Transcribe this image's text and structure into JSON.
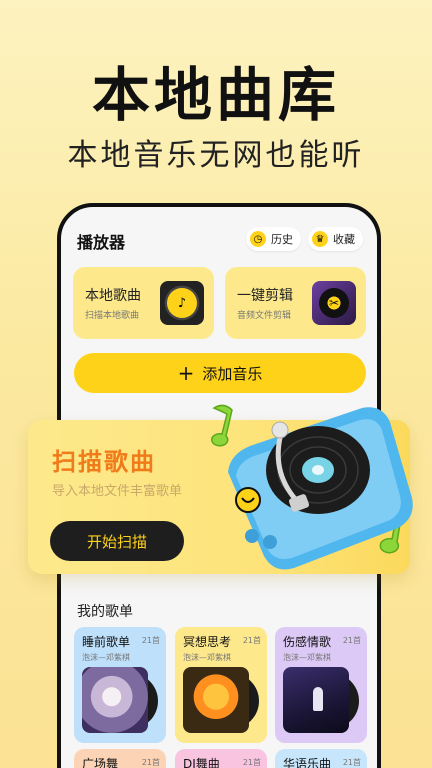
{
  "hero": {
    "title": "本地曲库",
    "subtitle": "本地音乐无网也能听"
  },
  "player": {
    "title": "播放器",
    "history_label": "历史",
    "favorites_label": "收藏",
    "cards": [
      {
        "title": "本地歌曲",
        "subtitle": "扫描本地歌曲"
      },
      {
        "title": "一键剪辑",
        "subtitle": "音频文件剪辑"
      }
    ],
    "add_music_label": "添加音乐"
  },
  "scan": {
    "title": "扫描歌曲",
    "subtitle": "导入本地文件丰富歌单",
    "button_label": "开始扫描"
  },
  "playlists": {
    "section_title": "我的歌单",
    "items": [
      {
        "name": "睡前歌单",
        "count": "21首",
        "artist": "泡沫—邓紫棋"
      },
      {
        "name": "冥想思考",
        "count": "21首",
        "artist": "泡沫—邓紫棋"
      },
      {
        "name": "伤感情歌",
        "count": "21首",
        "artist": "泡沫—邓紫棋"
      },
      {
        "name": "广场舞",
        "count": "21首"
      },
      {
        "name": "DJ舞曲",
        "count": "21首"
      },
      {
        "name": "华语乐曲",
        "count": "21首"
      }
    ]
  },
  "colors": {
    "accent": "#ffd21a",
    "scan_title": "#f07b1a",
    "dark": "#1e1e1e"
  },
  "icons": [
    "clock-icon",
    "crown-icon",
    "plus-icon",
    "vinyl-icon",
    "scissors-icon",
    "turntable-illustration"
  ]
}
